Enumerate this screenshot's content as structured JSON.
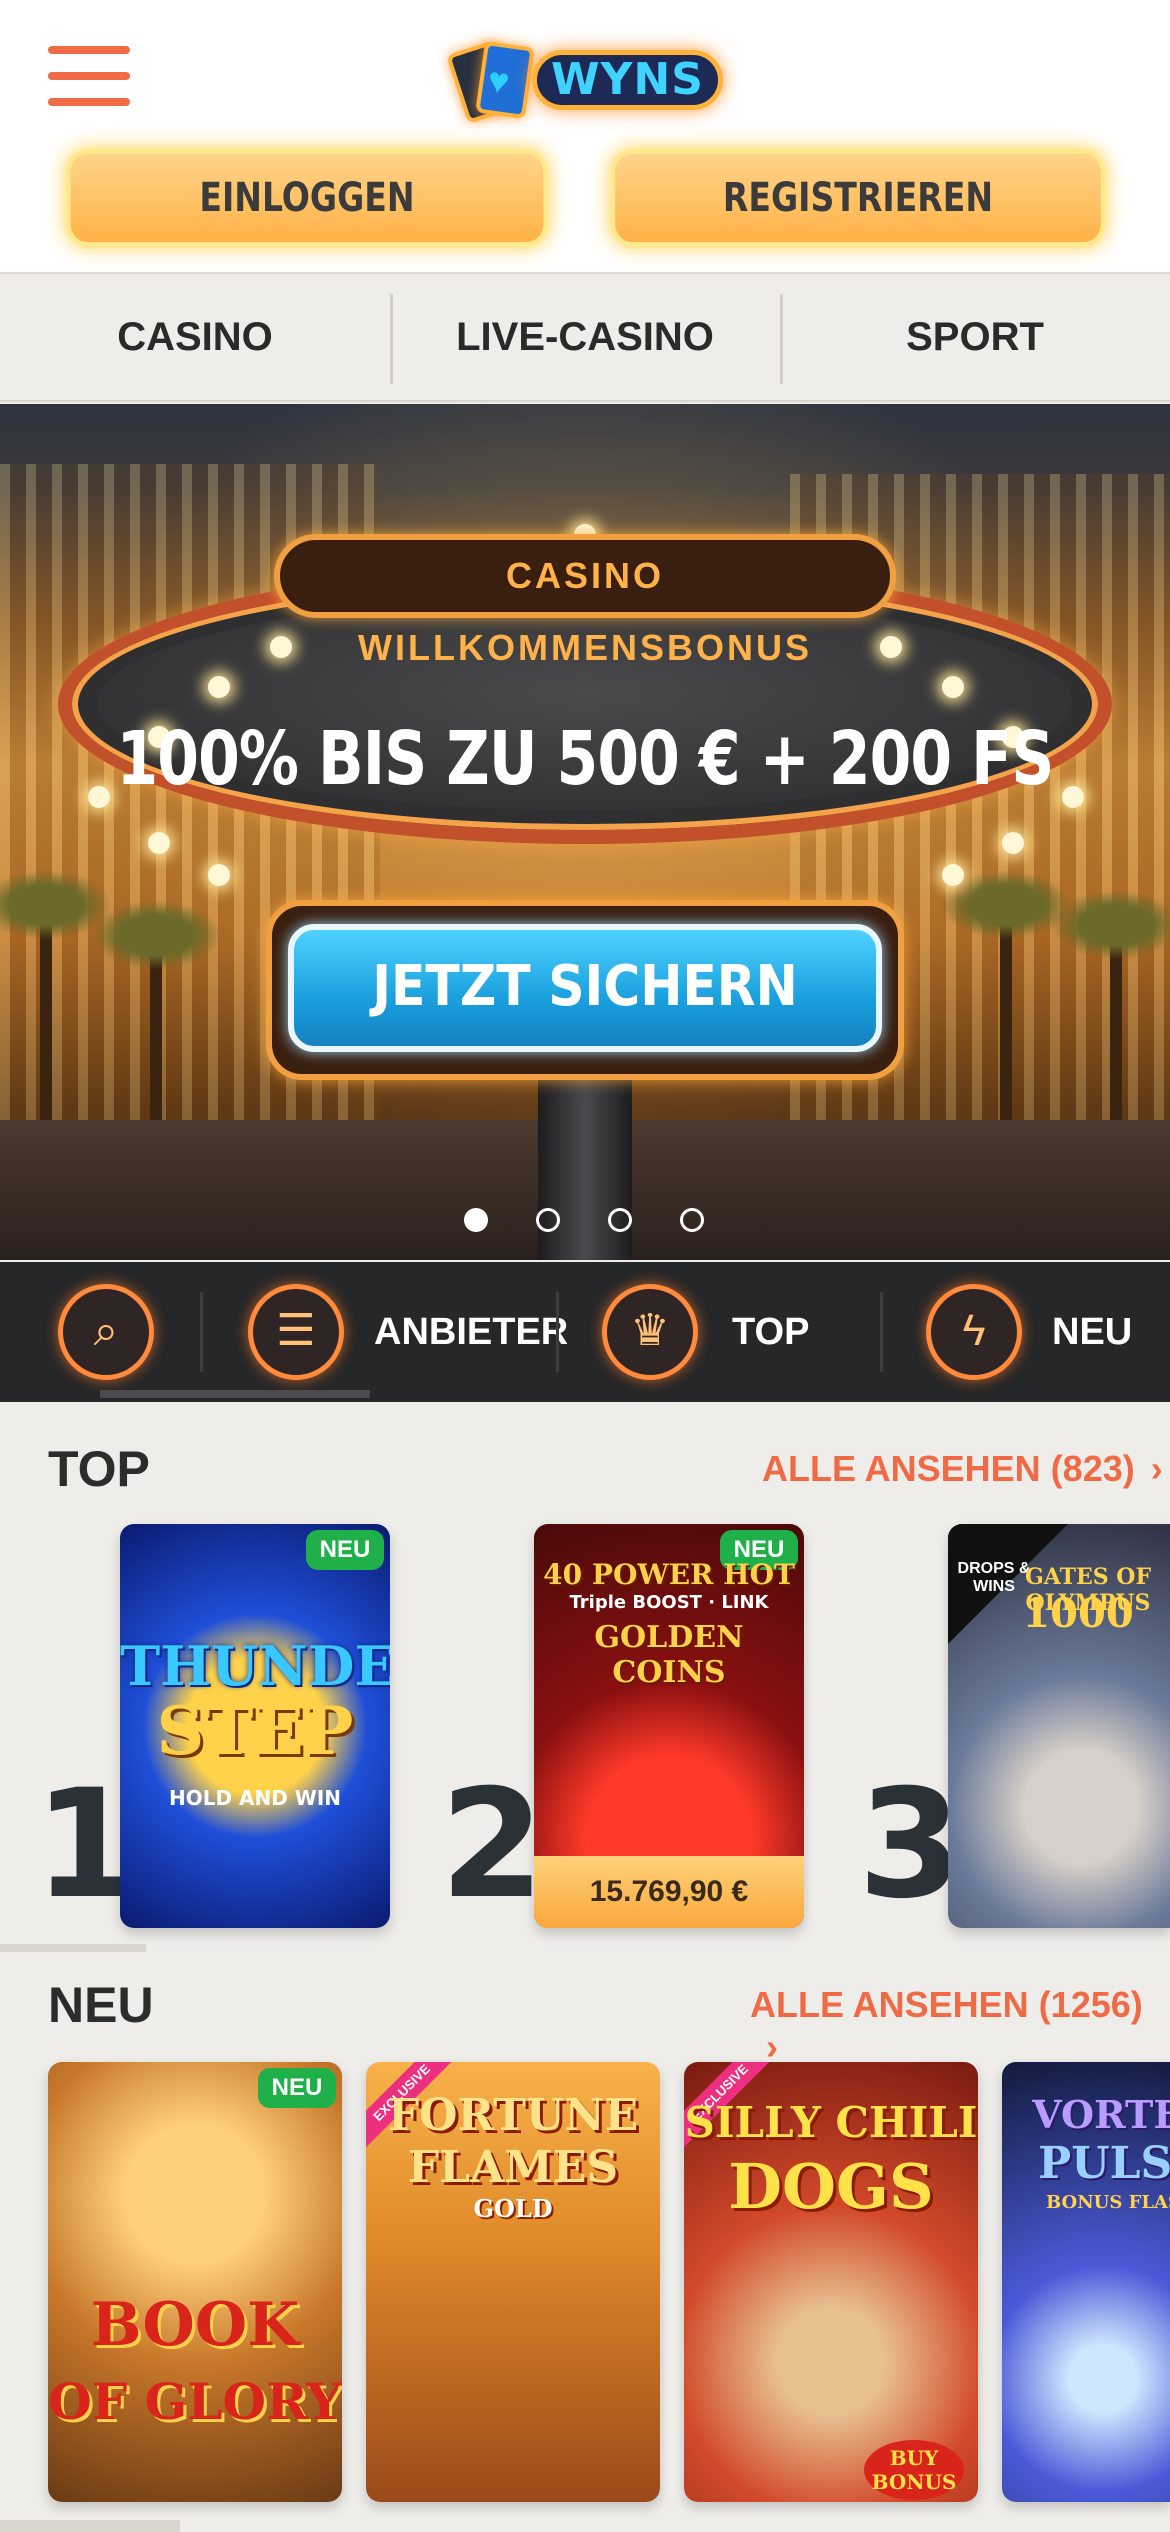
{
  "header": {
    "logo_text": "WYNS",
    "login_label": "EINLOGGEN",
    "register_label": "REGISTRIEREN"
  },
  "tabs": [
    {
      "label": "CASINO"
    },
    {
      "label": "LIVE-CASINO"
    },
    {
      "label": "SPORT"
    }
  ],
  "hero": {
    "sign_title": "CASINO WILLKOMMENSBONUS",
    "headline": "100% BIS ZU 500 € + 200 FS",
    "cta_label": "JETZT SICHERN",
    "slides_total": 4,
    "active_slide": 1
  },
  "quicknav": {
    "items": [
      {
        "icon": "search-icon",
        "label": ""
      },
      {
        "icon": "document-icon",
        "label": "ANBIETER"
      },
      {
        "icon": "crown-icon",
        "label": "TOP"
      },
      {
        "icon": "lightning-icon",
        "label": "NEU"
      }
    ]
  },
  "sections": {
    "top": {
      "title": "TOP",
      "see_all": "ALLE ANSEHEN (823)",
      "games": [
        {
          "rank": "1",
          "title_line1": "THUNDER",
          "title_line2": "STEP",
          "subtitle": "HOLD AND WIN",
          "badge": "NEU"
        },
        {
          "rank": "2",
          "title_line1": "40 POWER HOT",
          "title_line2": "GOLDEN COINS",
          "subtitle": "Triple BOOST · LINK",
          "badge": "NEU",
          "jackpot": "15.769,90 €"
        },
        {
          "rank": "3",
          "title_line1": "GATES OF OLYMPUS",
          "title_line2": "1000",
          "subtitle": "DROPS & WINS"
        }
      ]
    },
    "new": {
      "title": "NEU",
      "see_all": "ALLE ANSEHEN (1256)",
      "games": [
        {
          "title_line1": "BOOK",
          "title_line2": "OF GLORY",
          "badge": "NEU"
        },
        {
          "title_line1": "FORTUNE",
          "title_line2": "FLAMES",
          "subtitle": "GOLD",
          "ribbon": "EXCLUSIVE"
        },
        {
          "title_line1": "SILLY CHILI",
          "title_line2": "DOGS",
          "subtitle": "BUY BONUS",
          "ribbon": "EXCLUSIVE"
        },
        {
          "title_line1": "VORTEX",
          "title_line2": "PULSE",
          "subtitle": "BONUS FLASH"
        }
      ]
    }
  },
  "colors": {
    "accent": "#ef6a45",
    "button_gold": "#ffb247",
    "cta_blue": "#1a9fdd",
    "badge_green": "#1fb04a",
    "nav_dark": "#262728"
  }
}
